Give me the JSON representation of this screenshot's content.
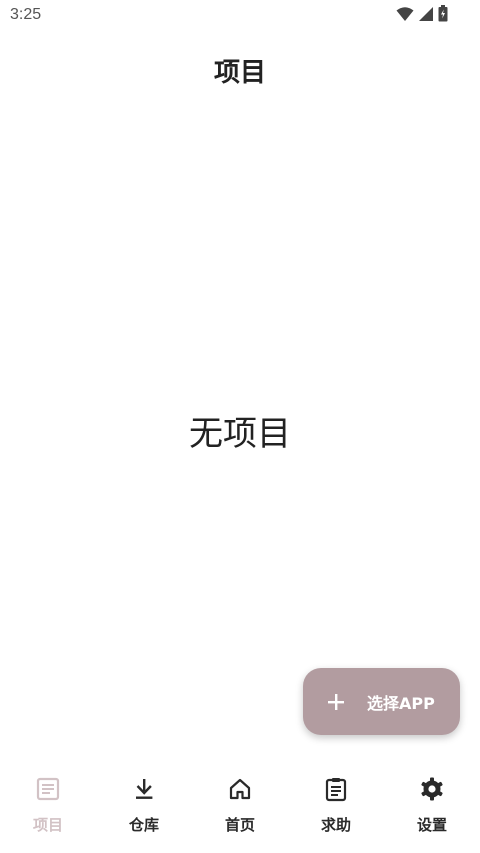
{
  "status_bar": {
    "time": "3:25"
  },
  "header": {
    "title": "项目"
  },
  "main": {
    "empty_message": "无项目"
  },
  "fab": {
    "label": "选择APP",
    "icon": "plus-icon"
  },
  "bottom_nav": {
    "items": [
      {
        "label": "项目",
        "icon": "document-icon",
        "active": true
      },
      {
        "label": "仓库",
        "icon": "download-icon",
        "active": false
      },
      {
        "label": "首页",
        "icon": "home-icon",
        "active": false
      },
      {
        "label": "求助",
        "icon": "clipboard-icon",
        "active": false
      },
      {
        "label": "设置",
        "icon": "gear-icon",
        "active": false
      }
    ]
  },
  "colors": {
    "fab_background": "#b29ca0",
    "active_nav": "#d2c2c5",
    "text_primary": "#222222"
  }
}
